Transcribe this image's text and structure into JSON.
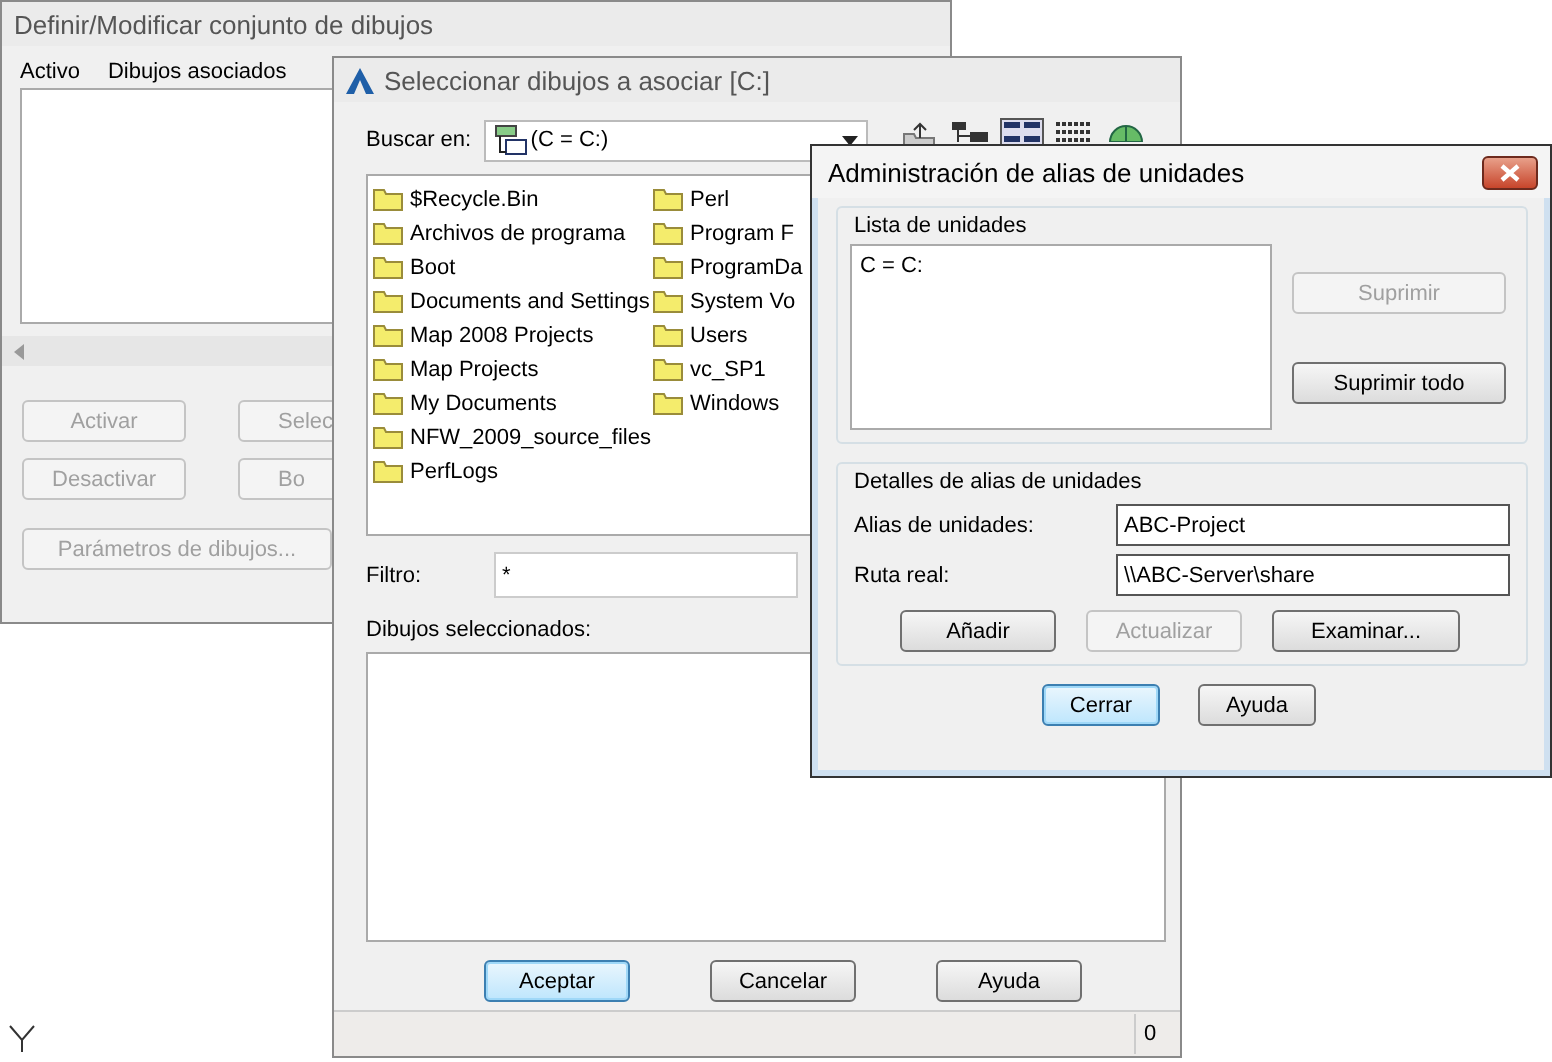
{
  "set_dialog": {
    "title": "Definir/Modificar conjunto de dibujos",
    "columns": [
      "Activo",
      "Dibujos asociados"
    ],
    "buttons": [
      {
        "label": "Activar",
        "disabled": true
      },
      {
        "label": "Selec",
        "disabled": true
      },
      {
        "label": "Desactivar",
        "disabled": true
      },
      {
        "label": "Bo",
        "disabled": true
      },
      {
        "label": "Parámetros de dibujos...",
        "disabled": true
      }
    ]
  },
  "select_dialog": {
    "title": "Seleccionar dibujos a asociar [C:]",
    "look_in": {
      "label": "Buscar en:",
      "value": "(C = C:)"
    },
    "tools": [
      {
        "kind": "up",
        "selected": false
      },
      {
        "kind": "tree",
        "selected": false
      },
      {
        "kind": "list",
        "selected": true
      },
      {
        "kind": "details",
        "selected": false
      },
      {
        "kind": "web",
        "selected": false
      }
    ],
    "files": [
      "$Recycle.Bin",
      "Archivos de programa",
      "Boot",
      "Documents and Settings",
      "Map 2008 Projects",
      "Map Projects",
      "My Documents",
      "NFW_2009_source_files",
      "PerfLogs",
      "Perl",
      "Program F",
      "ProgramDa",
      "System Vo",
      "Users",
      "vc_SP1",
      "Windows"
    ],
    "filter": {
      "label": "Filtro:",
      "value": "*"
    },
    "selected_label": "Dibujos seleccionados:",
    "buttons": [
      {
        "label": "Aceptar",
        "default": true
      },
      {
        "label": "Cancelar",
        "default": false
      },
      {
        "label": "Ayuda",
        "default": false
      }
    ],
    "status": "0"
  },
  "alias_dialog": {
    "title": "Administración de alias de unidades",
    "close_button": true,
    "list_group": {
      "legend": "Lista de unidades",
      "items": [
        "C = C:"
      ],
      "buttons": [
        {
          "label": "Suprimir",
          "disabled": true
        },
        {
          "label": "Suprimir todo",
          "disabled": false
        }
      ]
    },
    "details_group": {
      "legend": "Detalles de alias de unidades",
      "fields": [
        {
          "label": "Alias de unidades:",
          "value": "ABC-Project"
        },
        {
          "label": "Ruta real:",
          "value": "\\\\ABC-Server\\share"
        }
      ],
      "buttons": [
        {
          "label": "Añadir",
          "disabled": false
        },
        {
          "label": "Actualizar",
          "disabled": true
        },
        {
          "label": "Examinar...",
          "disabled": false
        }
      ]
    },
    "buttons": [
      {
        "label": "Cerrar",
        "default": true
      },
      {
        "label": "Ayuda",
        "default": false
      }
    ]
  }
}
